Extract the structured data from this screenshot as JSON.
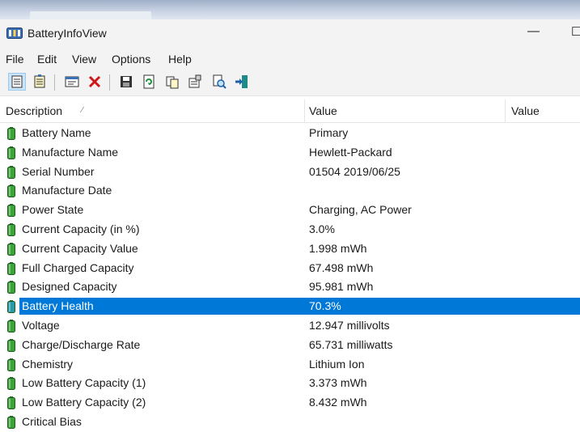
{
  "window": {
    "title": "BatteryInfoView",
    "minimize_glyph": "—",
    "maximize_glyph": "☐"
  },
  "menu": [
    "File",
    "Edit",
    "View",
    "Options",
    "Help"
  ],
  "toolbar": {
    "buttons": [
      {
        "name": "view-properties-icon",
        "pressed": true
      },
      {
        "name": "view-log-icon",
        "pressed": false
      },
      {
        "name": "window-icon",
        "pressed": false
      },
      {
        "name": "delete-icon",
        "pressed": false
      },
      {
        "name": "save-icon",
        "pressed": false
      },
      {
        "name": "refresh-icon",
        "pressed": false
      },
      {
        "name": "copy-icon",
        "pressed": false
      },
      {
        "name": "properties-icon",
        "pressed": false
      },
      {
        "name": "find-icon",
        "pressed": false
      },
      {
        "name": "exit-icon",
        "pressed": false
      }
    ]
  },
  "columns": {
    "description": "Description",
    "value": "Value",
    "value2": "Value"
  },
  "rows": [
    {
      "desc": "Battery Name",
      "val": "Primary"
    },
    {
      "desc": "Manufacture Name",
      "val": "Hewlett-Packard"
    },
    {
      "desc": "Serial Number",
      "val": "01504 2019/06/25"
    },
    {
      "desc": "Manufacture Date",
      "val": ""
    },
    {
      "desc": "Power State",
      "val": "Charging, AC Power"
    },
    {
      "desc": "Current Capacity (in %)",
      "val": "3.0%"
    },
    {
      "desc": "Current Capacity Value",
      "val": "1.998 mWh"
    },
    {
      "desc": "Full Charged Capacity",
      "val": "67.498 mWh"
    },
    {
      "desc": "Designed Capacity",
      "val": "95.981 mWh"
    },
    {
      "desc": "Battery Health",
      "val": "70.3%",
      "selected": true
    },
    {
      "desc": "Voltage",
      "val": "12.947 millivolts"
    },
    {
      "desc": "Charge/Discharge Rate",
      "val": "65.731 milliwatts"
    },
    {
      "desc": "Chemistry",
      "val": "Lithium Ion"
    },
    {
      "desc": "Low Battery Capacity (1)",
      "val": "3.373 mWh"
    },
    {
      "desc": "Low Battery Capacity (2)",
      "val": "8.432 mWh"
    },
    {
      "desc": "Critical Bias",
      "val": ""
    }
  ],
  "colors": {
    "selection": "#0078d7",
    "battery_green": "#3aa33a",
    "battery_selected": "#2a9aa8"
  }
}
